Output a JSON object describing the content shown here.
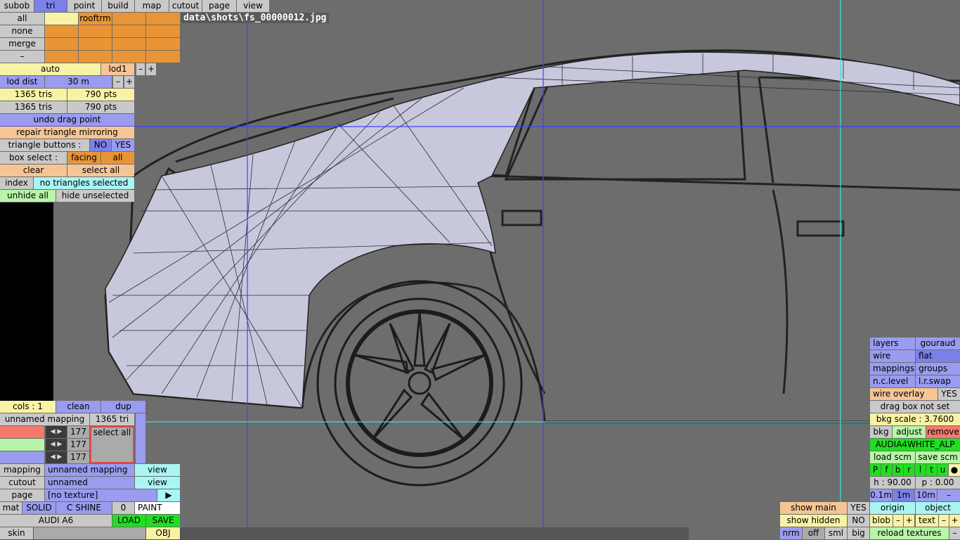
{
  "filename": "data\\shots\\fs_00000012.jpg",
  "top_tabs": [
    "subob",
    "tri",
    "point",
    "build",
    "map",
    "cutout",
    "page",
    "view"
  ],
  "subobj": {
    "all": "all",
    "none": "none",
    "merge": "merge",
    "dash": "–",
    "rooftrm": "rooftrm"
  },
  "lod": {
    "auto": "auto",
    "lod1": "lod1",
    "minus": "–",
    "plus": "+",
    "dist_label": "lod dist",
    "dist_value": "30 m"
  },
  "counts": {
    "tris1": "1365 tris",
    "pts1": "790 pts",
    "tris2": "1365 tris",
    "pts2": "790 pts"
  },
  "actions": {
    "undo": "undo drag point",
    "repair": "repair triangle mirroring",
    "tri_buttons": "triangle buttons :",
    "no": "NO",
    "yes": "YES",
    "box_select": "box select :",
    "facing": "facing",
    "all": "all",
    "clear": "clear",
    "select_all": "select all",
    "index": "index",
    "no_tri": "no triangles selected",
    "unhide": "unhide all",
    "hide_unsel": "hide unselected"
  },
  "mapping_panel": {
    "cols": "cols : 1",
    "clean": "clean",
    "dup": "dup",
    "unnamed_mapping": "unnamed mapping",
    "tri_count": "1365 tri",
    "v1": "177",
    "v2": "177",
    "v3": "177",
    "select_all": "select all",
    "mapping_lbl": "mapping",
    "mapping_val": "unnamed mapping",
    "view": "view",
    "cutout_lbl": "cutout",
    "cutout_val": "unnamed",
    "page_lbl": "page",
    "page_val": "[no texture]",
    "arrow": "▶",
    "mat": "mat",
    "solid": "SOLID",
    "cshine": "C SHINE",
    "zero": "0",
    "paint": "PAINT",
    "car": "AUDI A6",
    "load": "LOAD",
    "save": "SAVE",
    "skin": "skin",
    "obj": "OBJ"
  },
  "right_panel": {
    "layers": "layers",
    "gouraud": "gouraud",
    "wire": "wire",
    "flat": "flat",
    "mappings": "mappings",
    "groups": "groups",
    "nclevel": "n.c.level",
    "lrswap": "l.r.swap",
    "wire_overlay": "wire overlay",
    "yes": "YES",
    "drag_box": "drag box not set",
    "bkg_scale": "bkg scale : 3.7600",
    "bkg": "bkg",
    "adjust": "adjust",
    "remove": "remove",
    "texture_name": "AUDIA4WHITE_ALP",
    "load_scm": "load scm",
    "save_scm": "save scm",
    "views": [
      "P",
      "f",
      "b",
      "r",
      "l",
      "t",
      "u",
      "●"
    ],
    "h": "h : 90.00",
    "p": "p : 0.00",
    "step1": "0.1m",
    "step2": "1m",
    "step3": "10m",
    "minus": "–",
    "origin": "origin",
    "object": "object",
    "blob": "blob",
    "text": "text",
    "plus": "+",
    "reload": "reload textures"
  },
  "bottom_mid": {
    "show_main": "show main",
    "show_main_val": "YES",
    "show_hidden": "show hidden",
    "show_hidden_val": "NO",
    "nrm": "nrm",
    "off": "off",
    "sml": "sml",
    "big": "big"
  }
}
